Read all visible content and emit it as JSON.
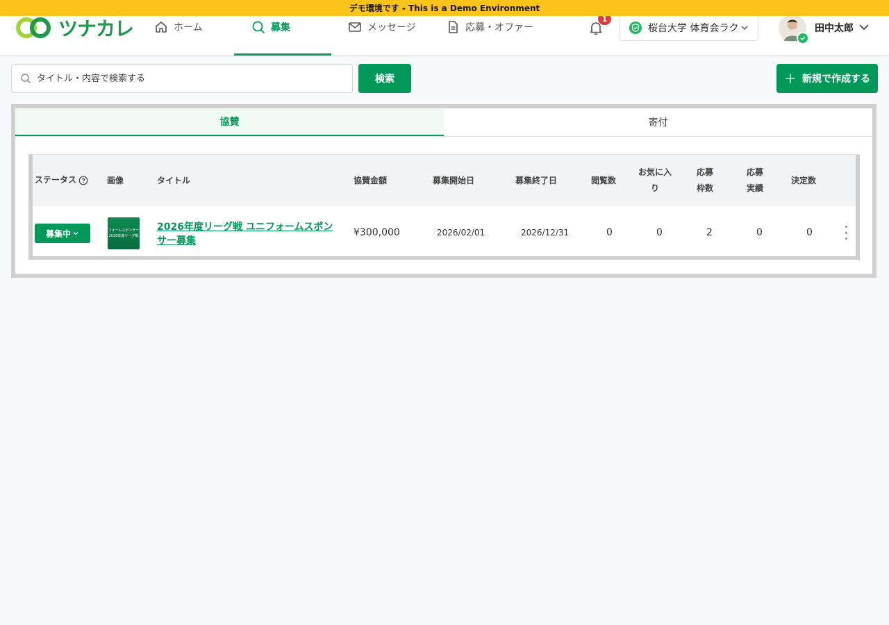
{
  "banner": {
    "text": "デモ環境です - This is a Demo Environment"
  },
  "brand": {
    "name": "ツナカレ",
    "color": "#1a9a4a"
  },
  "nav": {
    "items": [
      {
        "label": "ホーム",
        "icon": "home-icon"
      },
      {
        "label": "募集",
        "icon": "search-icon",
        "active": true
      },
      {
        "label": "メッセージ",
        "icon": "mail-icon"
      },
      {
        "label": "応募・オファー",
        "icon": "document-icon"
      }
    ]
  },
  "notifications": {
    "count": "1"
  },
  "org": {
    "label": "桜台大学 体育会ラク"
  },
  "user": {
    "name": "田中太郎"
  },
  "search": {
    "placeholder": "タイトル・内容で検索する",
    "button_label": "検索"
  },
  "create": {
    "label": "新規で作成する"
  },
  "tabs": [
    {
      "label": "協賛",
      "active": true
    },
    {
      "label": "寄付",
      "active": false
    }
  ],
  "table": {
    "headers": {
      "status": "ステータス",
      "image": "画像",
      "title": "タイトル",
      "amount": "協賛金額",
      "start": "募集開始日",
      "end": "募集終了日",
      "views": "閲覧数",
      "favorites_1": "お気に入",
      "favorites_2": "り",
      "slots_1": "応募",
      "slots_2": "枠数",
      "results_1": "応募",
      "results_2": "実績",
      "decided": "決定数"
    },
    "rows": [
      {
        "status": "募集中",
        "thumb_line1": "フォームスポンサー",
        "thumb_line2": "2026年度リーグ戦",
        "title": "2026年度リーグ戦 ユニフォームスポンサー募集",
        "amount": "¥300,000",
        "start": "2026/02/01",
        "end": "2026/12/31",
        "views": "0",
        "favorites": "0",
        "slots": "2",
        "results": "0",
        "decided": "0"
      }
    ]
  },
  "colors": {
    "primary": "#00995a",
    "banner": "#fcc418",
    "badge": "#e53935"
  }
}
